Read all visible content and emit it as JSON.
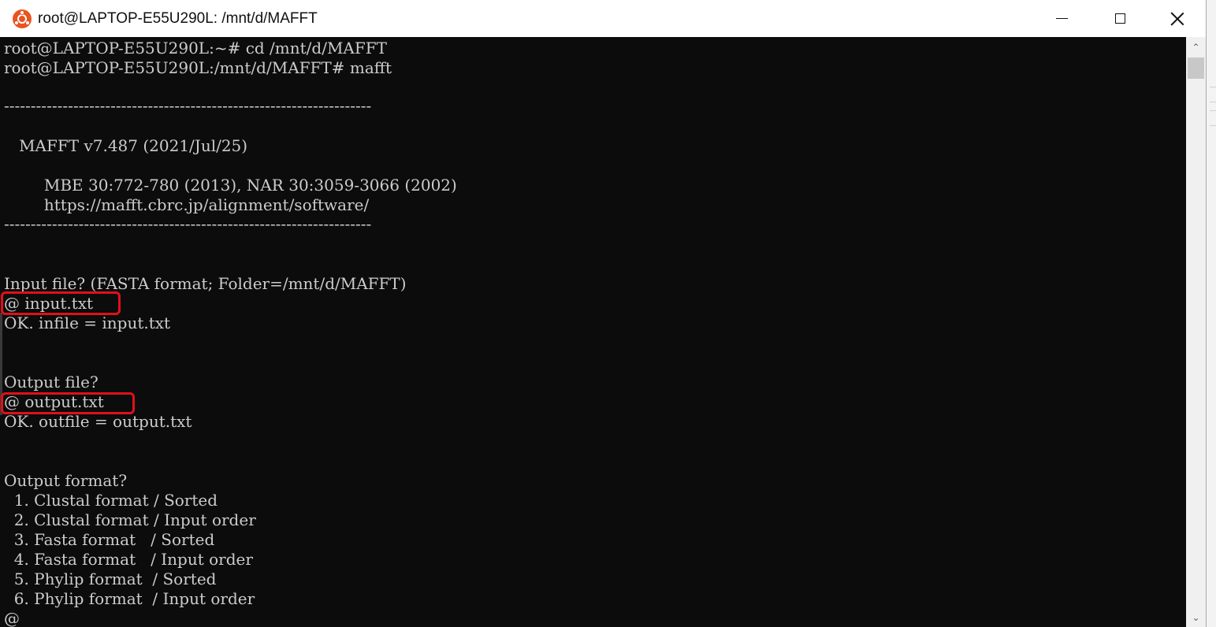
{
  "window": {
    "title": "root@LAPTOP-E55U290L: /mnt/d/MAFFT",
    "icon": "ubuntu-logo-icon",
    "accent_color": "#e95420",
    "controls": {
      "minimize": "minimize-icon",
      "maximize": "maximize-icon",
      "close": "close-icon"
    }
  },
  "terminal": {
    "background": "#0c0c0c",
    "foreground": "#cccccc",
    "highlight_color": "#e0101a",
    "lines": [
      "root@LAPTOP-E55U290L:~# cd /mnt/d/MAFFT",
      "root@LAPTOP-E55U290L:/mnt/d/MAFFT# mafft",
      "",
      "---------------------------------------------------------------------",
      "",
      "   MAFFT v7.487 (2021/Jul/25)",
      "",
      "        MBE 30:772-780 (2013), NAR 30:3059-3066 (2002)",
      "        https://mafft.cbrc.jp/alignment/software/",
      "---------------------------------------------------------------------",
      "",
      "",
      "Input file? (FASTA format; Folder=/mnt/d/MAFFT)",
      "@ input.txt",
      "OK. infile = input.txt",
      "",
      "",
      "Output file?",
      "@ output.txt",
      "OK. outfile = output.txt",
      "",
      "",
      "Output format?",
      "  1. Clustal format / Sorted",
      "  2. Clustal format / Input order",
      "  3. Fasta format   / Sorted",
      "  4. Fasta format   / Input order",
      "  5. Phylip format  / Sorted",
      "  6. Phylip format  / Input order",
      "@"
    ]
  },
  "scrollbar": {
    "up_icon": "scroll-up-arrow-icon",
    "down_icon": "scroll-down-arrow-icon",
    "up_glyph": "⌃",
    "down_glyph": "⌄"
  }
}
